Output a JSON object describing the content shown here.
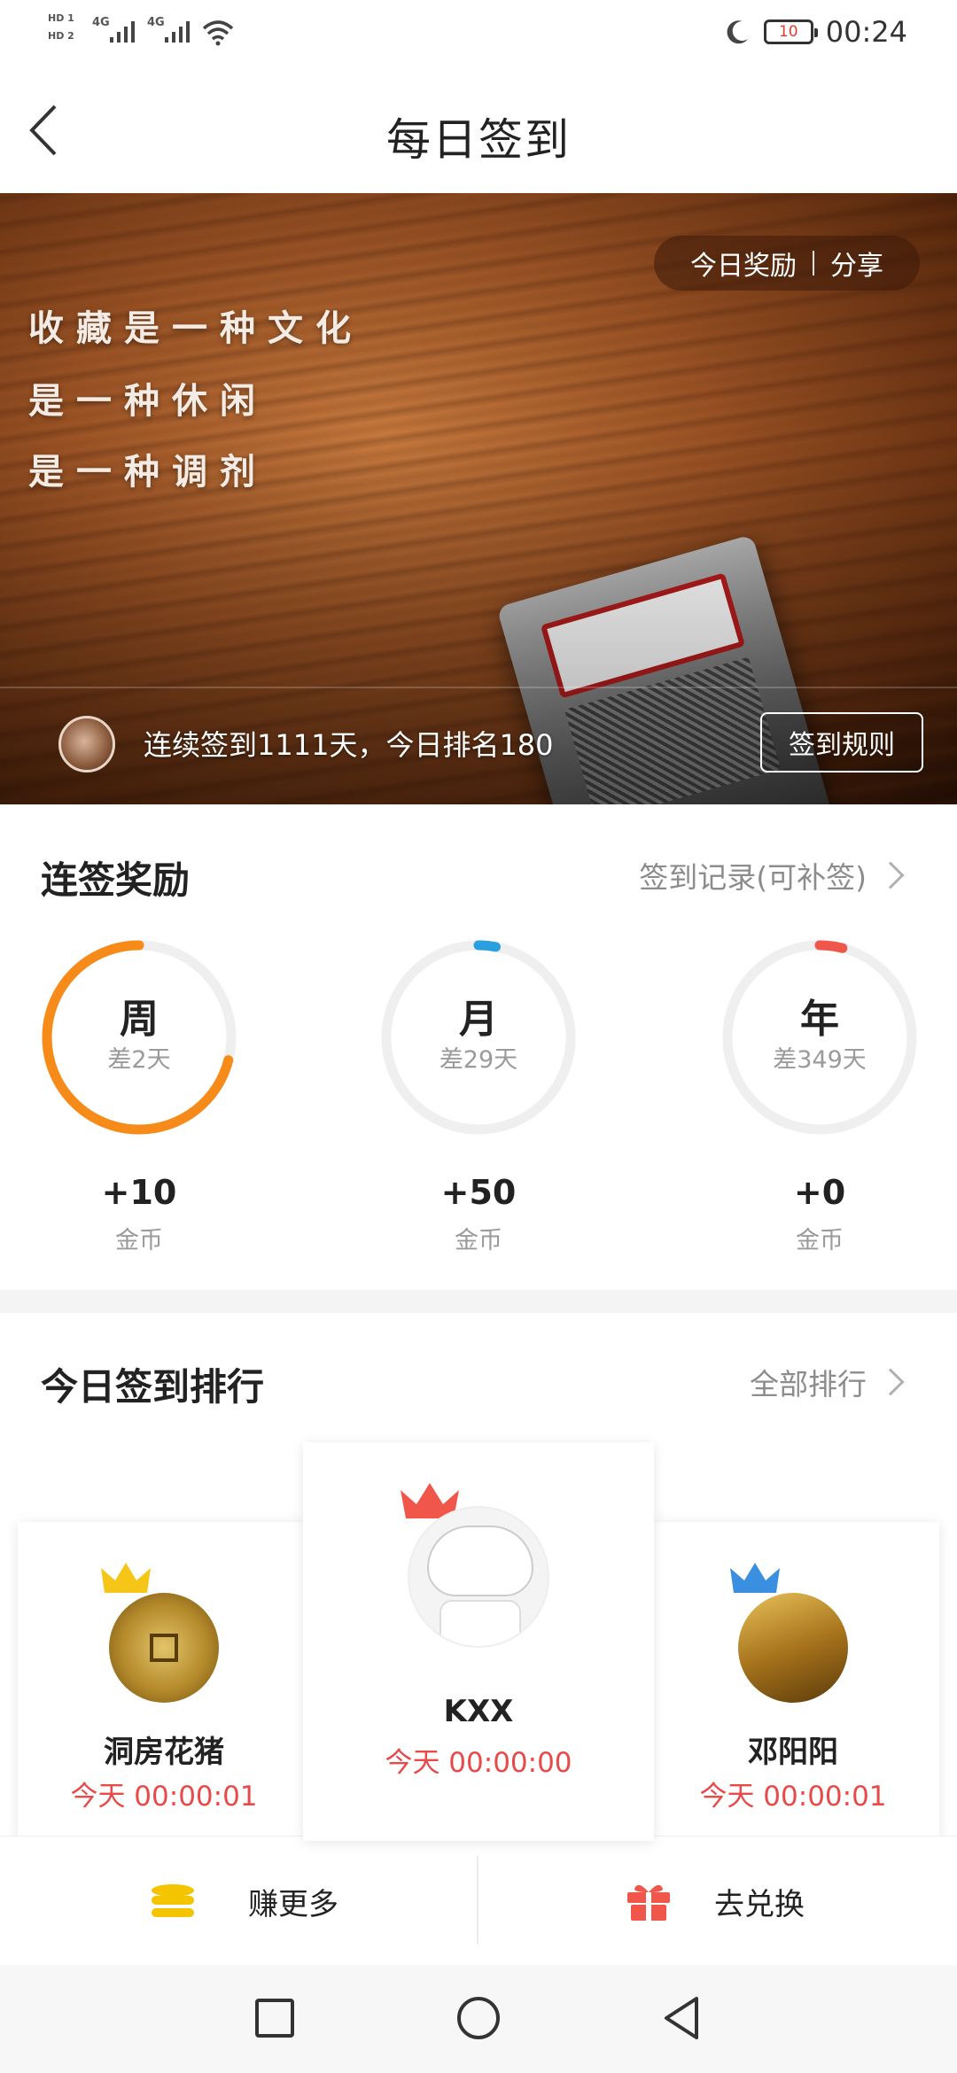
{
  "status_bar": {
    "left_labels": [
      "HD 1",
      "HD 2"
    ],
    "network_1": "4G",
    "network_2": "4G",
    "battery": "10",
    "time": "00:24"
  },
  "header": {
    "title": "每日签到"
  },
  "banner": {
    "reward_label": "今日奖励",
    "share_label": "分享",
    "slogan_lines": [
      "收藏是一种文化",
      "是一种休闲",
      "是一种调剂"
    ],
    "streak_text": "连续签到1111天，今日排名180",
    "rules_label": "签到规则"
  },
  "streak_rewards": {
    "title": "连签奖励",
    "record_link": "签到记录(可补签)",
    "items": [
      {
        "label": "周",
        "remaining": "差2天",
        "coins": "+10",
        "unit": "金币",
        "progress": 0.71,
        "color": "#f78b1a"
      },
      {
        "label": "月",
        "remaining": "差29天",
        "coins": "+50",
        "unit": "金币",
        "progress": 0.03,
        "color": "#2a9fe0"
      },
      {
        "label": "年",
        "remaining": "差349天",
        "coins": "+0",
        "unit": "金币",
        "progress": 0.04,
        "color": "#f0574a"
      }
    ]
  },
  "ranking": {
    "title": "今日签到排行",
    "all_link": "全部排行",
    "entries": [
      {
        "position": "second",
        "name": "洞房花猪",
        "time": "今天 00:00:01",
        "crown_color": "#f5c518"
      },
      {
        "position": "first",
        "name": "KXX",
        "time": "今天 00:00:00",
        "crown_color": "#f0574a"
      },
      {
        "position": "third",
        "name": "邓阳阳",
        "time": "今天 00:00:01",
        "crown_color": "#3b8fe0"
      }
    ]
  },
  "action_bar": {
    "earn_label": "赚更多",
    "exchange_label": "去兑换",
    "earn_icon": "coins-icon",
    "exchange_icon": "gift-icon",
    "earn_icon_color": "#f5c400",
    "exchange_icon_color": "#f0574a"
  }
}
